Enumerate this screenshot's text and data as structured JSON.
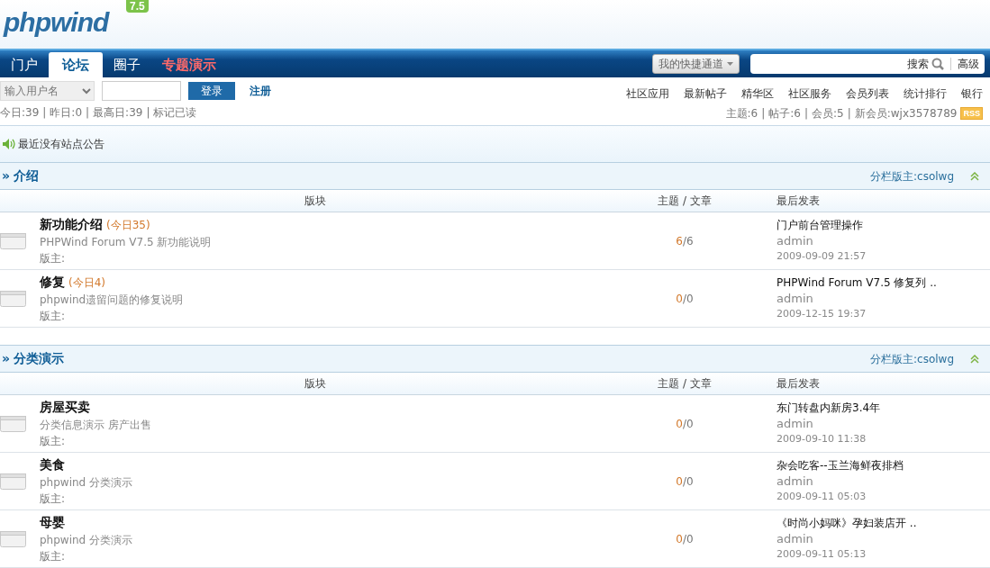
{
  "logo": {
    "name": "phpwind",
    "version": "7.5"
  },
  "nav": {
    "tabs": [
      {
        "label": "门户",
        "selected": false,
        "highlight": false
      },
      {
        "label": "论坛",
        "selected": true,
        "highlight": false
      },
      {
        "label": "圈子",
        "selected": false,
        "highlight": false
      },
      {
        "label": "专题演示",
        "selected": false,
        "highlight": true
      }
    ],
    "quick_menu": "我的快捷通道",
    "search_button": "搜索",
    "advanced_link": "高级"
  },
  "login": {
    "username_select": "输入用户名",
    "login_button": "登录",
    "register_link": "注册"
  },
  "stats": {
    "separator": "|",
    "items": [
      "今日:39",
      "昨日:0",
      "最高日:39"
    ],
    "mark_read_link": "标记已读"
  },
  "links": [
    "社区应用",
    "最新帖子",
    "精华区",
    "社区服务",
    "会员列表",
    "统计排行",
    "银行"
  ],
  "site_stats": {
    "items": [
      "主题:6",
      "帖子:6",
      "会员:5"
    ],
    "new_member_label": "新会员:",
    "new_member": "wjx3578789",
    "rss": "RSS"
  },
  "announcement": "最近没有站点公告",
  "sections": [
    {
      "marker": "»",
      "title": "介绍",
      "moderator": "分栏版主:csolwg",
      "expanded": true,
      "columns": [
        "版块",
        "主题 / 文章",
        "最后发表"
      ],
      "forums": [
        {
          "name": "新功能介绍",
          "today": "(今日35)",
          "description": "PHPWind Forum V7.5 新功能说明",
          "moderator_label": "版主:",
          "topics": "6",
          "separator": "/",
          "posts": "6",
          "last_title": "门户前台管理操作",
          "last_author": "admin",
          "last_time": "2009-09-09 21:57"
        },
        {
          "name": "修复",
          "today": "(今日4)",
          "description": "phpwind遗留问题的修复说明",
          "moderator_label": "版主:",
          "topics": "0",
          "separator": "/",
          "posts": "0",
          "last_title": "PHPWind Forum V7.5 修复列 ..",
          "last_author": "admin",
          "last_time": "2009-12-15 19:37"
        }
      ]
    },
    {
      "marker": "»",
      "title": "分类演示",
      "moderator": "分栏版主:csolwg",
      "expanded": true,
      "columns": [
        "版块",
        "主题 / 文章",
        "最后发表"
      ],
      "forums": [
        {
          "name": "房屋买卖",
          "description": "分类信息演示 房产出售",
          "moderator_label": "版主:",
          "topics": "0",
          "separator": "/",
          "posts": "0",
          "last_title": "东门转盘内新房3.4年",
          "last_author": "admin",
          "last_time": "2009-09-10 11:38"
        },
        {
          "name": "美食",
          "description": "phpwind 分类演示",
          "moderator_label": "版主:",
          "topics": "0",
          "separator": "/",
          "posts": "0",
          "last_title": "杂会吃客--玉兰海鲜夜排档",
          "last_author": "admin",
          "last_time": "2009-09-11 05:03"
        },
        {
          "name": "母婴",
          "description": "phpwind 分类演示",
          "moderator_label": "版主:",
          "topics": "0",
          "separator": "/",
          "posts": "0",
          "last_title": "《时尚小妈咪》孕妇装店开 ..",
          "last_author": "admin",
          "last_time": "2009-09-11 05:13"
        }
      ]
    }
  ]
}
